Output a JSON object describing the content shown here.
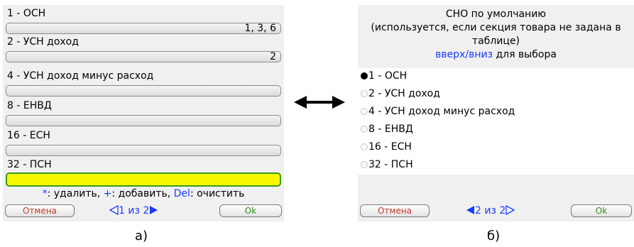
{
  "panel_a": {
    "fields": [
      {
        "label": "1 - ОСН",
        "value": "1, 3, 6"
      },
      {
        "label": "2 - УСН доход",
        "value": "2"
      },
      {
        "label": "4 - УСН доход минус расход",
        "value": ""
      },
      {
        "label": "8 - ЕНВД",
        "value": ""
      },
      {
        "label": "16 - ЕСН",
        "value": ""
      },
      {
        "label": "32 - ПСН",
        "value": ""
      }
    ],
    "hint": {
      "k1": "*",
      "t1": ": удалить, ",
      "k2": "+",
      "t2": ": добавить, ",
      "k3": "Del",
      "t3": ": очистить"
    },
    "cancel_label": "Отмена",
    "ok_label": "Ok",
    "pager_text": "1 из 2"
  },
  "panel_b": {
    "title_line1": "СНО по умолчанию",
    "title_line2": "(используется, если секция товара не задана в",
    "title_line3": "таблице)",
    "nav_keys": "вверх/вниз",
    "nav_text": " для выбора",
    "options": [
      {
        "label": "1 - ОСН",
        "selected": true
      },
      {
        "label": "2 - УСН доход",
        "selected": false
      },
      {
        "label": "4 - УСН доход минус расход",
        "selected": false
      },
      {
        "label": "8 - ЕНВД",
        "selected": false
      },
      {
        "label": "16 - ЕСН",
        "selected": false
      },
      {
        "label": "32 - ПСН",
        "selected": false
      }
    ],
    "cancel_label": "Отмена",
    "ok_label": "Ok",
    "pager_text": "2 из 2"
  },
  "arrow_icon": "double-arrow-icon",
  "captions": {
    "a": "а)",
    "b": "б)"
  },
  "colors": {
    "accent_blue": "#1a3cff",
    "active_field": "#f8f800",
    "active_border": "#3a9a1a",
    "cancel_red": "#c0392b",
    "ok_green": "#2e8b1a"
  }
}
